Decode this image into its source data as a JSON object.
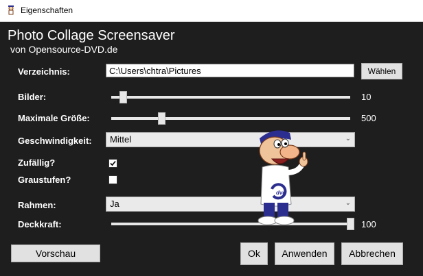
{
  "window": {
    "title": "Eigenschaften"
  },
  "header": {
    "title": "Photo Collage Screensaver",
    "subtitle": "von Opensource-DVD.de"
  },
  "fields": {
    "directory": {
      "label": "Verzeichnis:",
      "value": "C:\\Users\\chtra\\Pictures",
      "button": "Wählen"
    },
    "images": {
      "label": "Bilder:",
      "value": "10",
      "fraction": 0.05
    },
    "max_size": {
      "label": "Maximale Größe:",
      "value": "500",
      "fraction": 0.21
    },
    "speed": {
      "label": "Geschwindigkeit:",
      "selected": "Mittel"
    },
    "random": {
      "label": "Zufällig?",
      "checked": true
    },
    "grayscale": {
      "label": "Graustufen?",
      "checked": false
    },
    "frame": {
      "label": "Rahmen:",
      "selected": "Ja"
    },
    "opacity": {
      "label": "Deckkraft:",
      "value": "100",
      "fraction": 1.0
    }
  },
  "buttons": {
    "preview": "Vorschau",
    "ok": "Ok",
    "apply": "Anwenden",
    "cancel": "Abbrechen"
  },
  "mascot": {
    "logo_text": "dvd"
  },
  "colors": {
    "background": "#1e1e1e",
    "titlebar": "#ffffff",
    "button": "#e1e1e1",
    "accent": "#2b2d8f"
  },
  "icons": {
    "app": "screensaver-app-icon",
    "check": "check-icon",
    "dropdown": "chevron-down-icon"
  }
}
